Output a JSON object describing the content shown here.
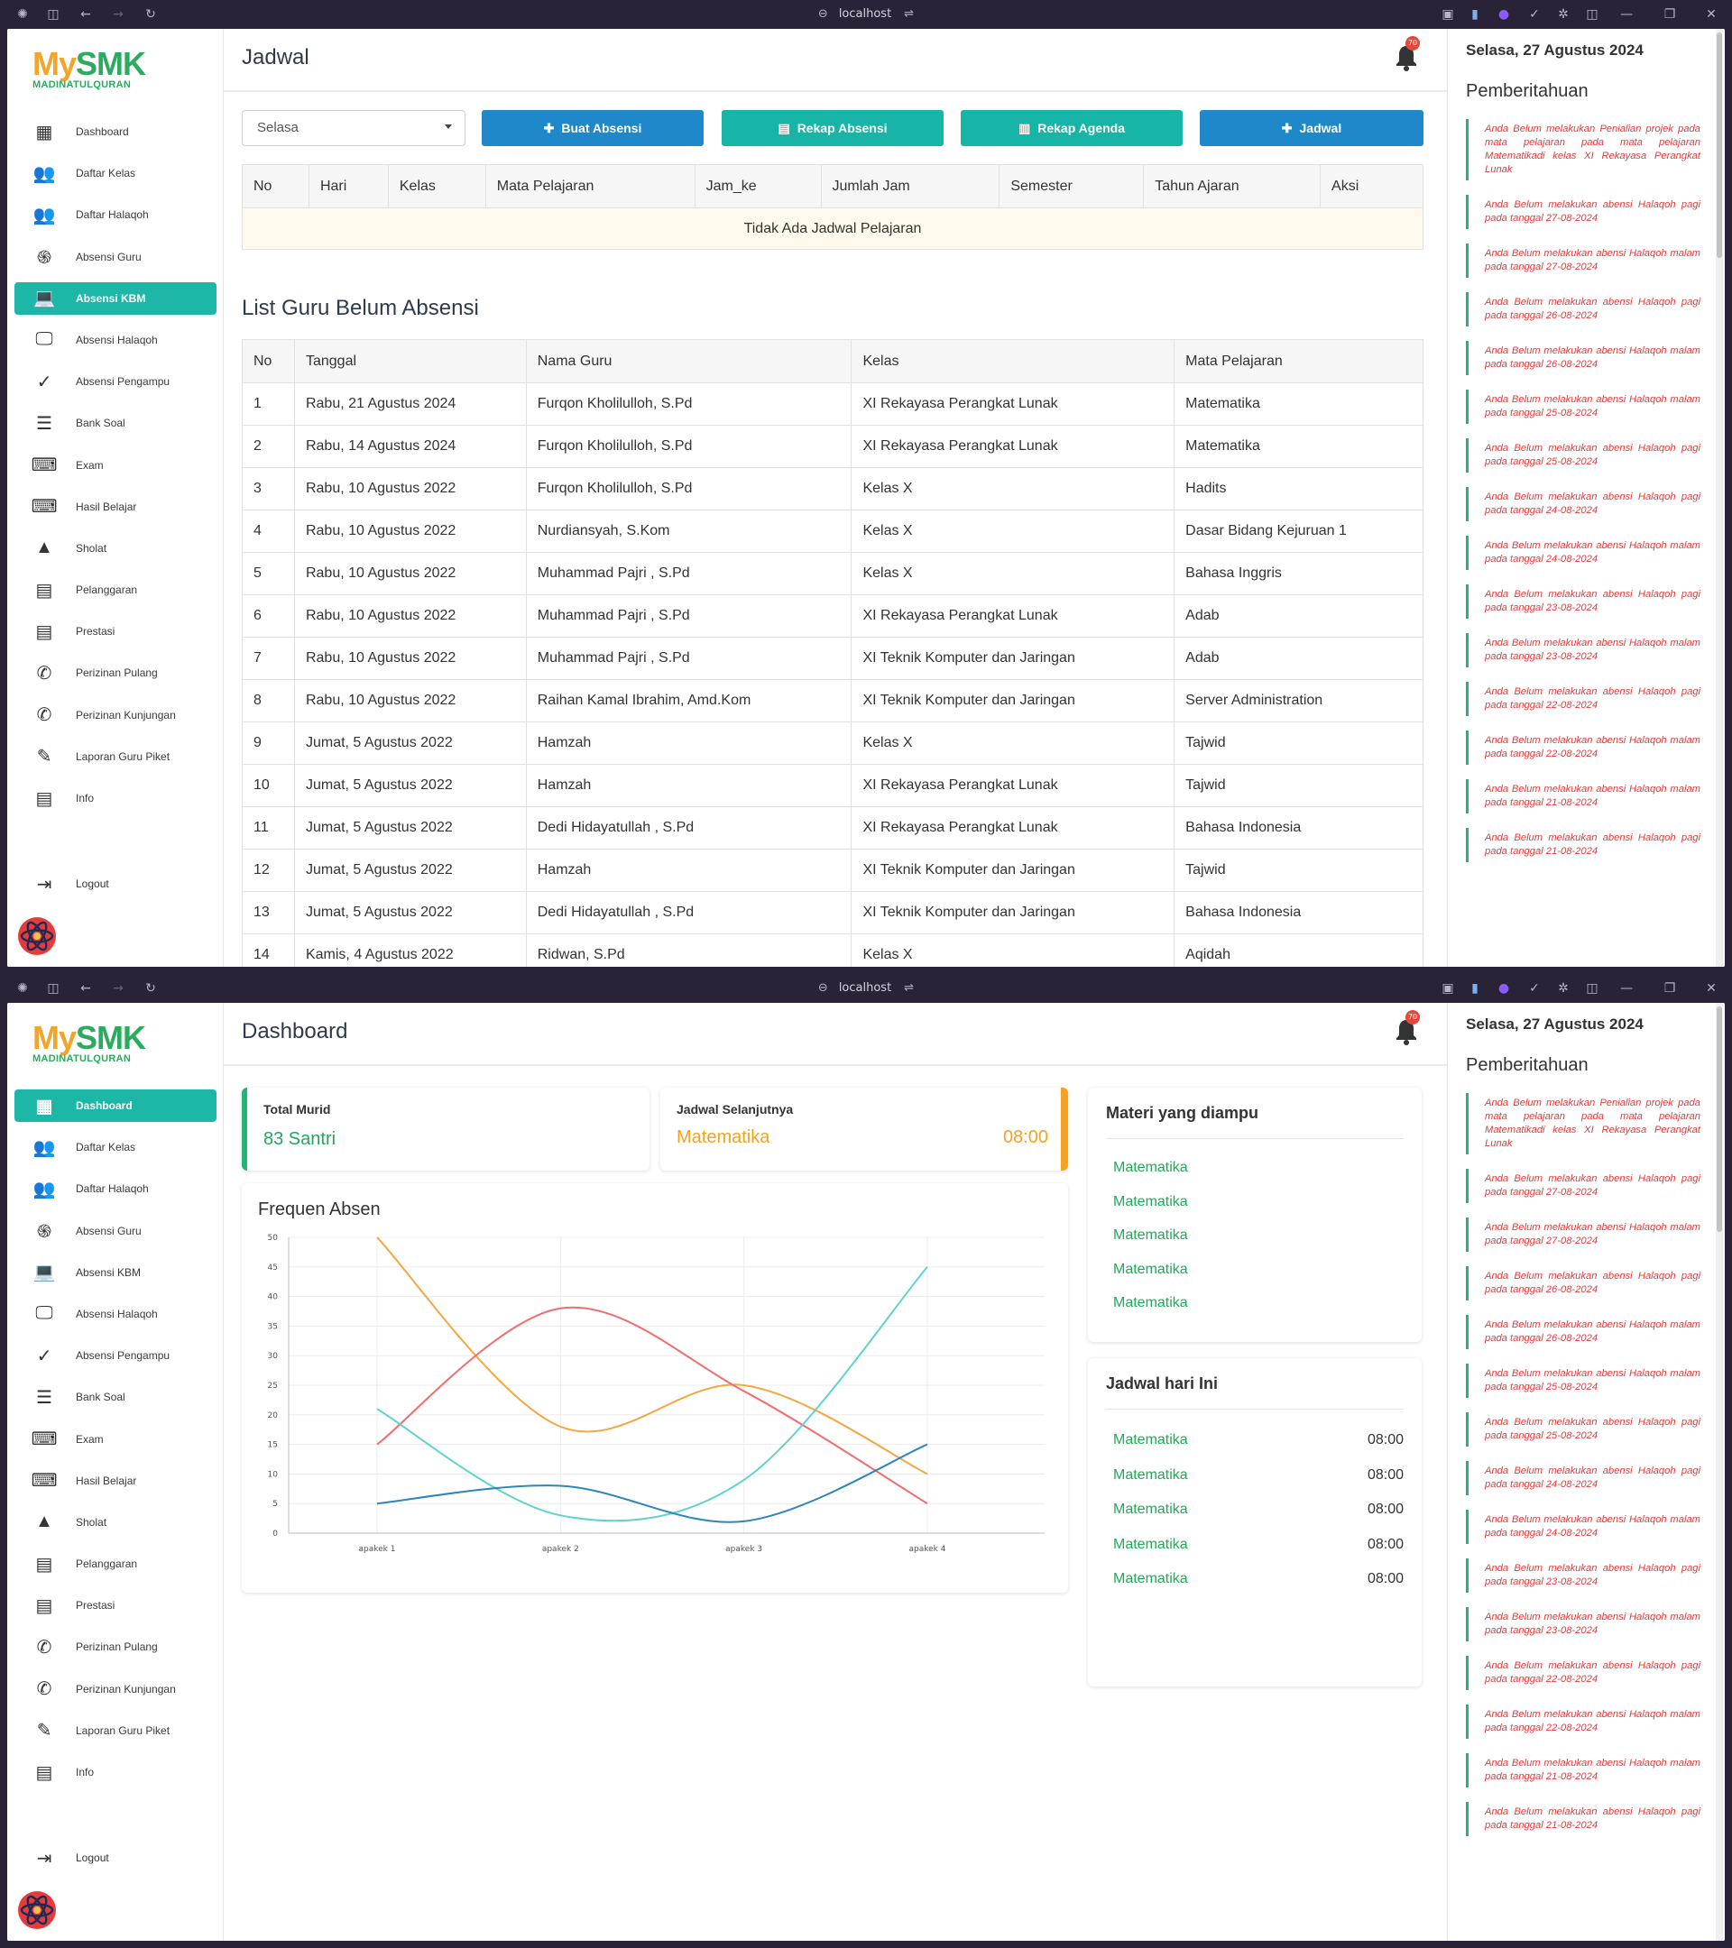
{
  "browser": {
    "url": "localhost"
  },
  "app": {
    "logo": {
      "my": "My",
      "smk": "SMK",
      "sub": "MADINATULQURAN"
    },
    "nav": [
      {
        "label": "Dashboard",
        "icon": "dashboard-icon"
      },
      {
        "label": "Daftar Kelas",
        "icon": "people-icon"
      },
      {
        "label": "Daftar Halaqoh",
        "icon": "group-icon"
      },
      {
        "label": "Absensi Guru",
        "icon": "fingerprint-icon"
      },
      {
        "label": "Absensi KBM",
        "icon": "laptop-icon"
      },
      {
        "label": "Absensi Halaqoh",
        "icon": "monitor-icon"
      },
      {
        "label": "Absensi Pengampu",
        "icon": "check-icon"
      },
      {
        "label": "Bank Soal",
        "icon": "align-icon"
      },
      {
        "label": "Exam",
        "icon": "keyboard-icon"
      },
      {
        "label": "Hasil Belajar",
        "icon": "keyboard-icon"
      },
      {
        "label": "Sholat",
        "icon": "navigation-icon"
      },
      {
        "label": "Pelanggaran",
        "icon": "list-doc-icon"
      },
      {
        "label": "Prestasi",
        "icon": "list-doc-icon"
      },
      {
        "label": "Perizinan Pulang",
        "icon": "phone-forward-icon"
      },
      {
        "label": "Perizinan Kunjungan",
        "icon": "phone-disabled-icon"
      },
      {
        "label": "Laporan Guru Piket",
        "icon": "pencil-icon"
      },
      {
        "label": "Info",
        "icon": "list-doc-icon"
      }
    ],
    "logout": "Logout",
    "notif_count": "70",
    "date": "Selasa, 27 Agustus 2024",
    "notif_title": "Pemberitahuan",
    "notifications": [
      "Anda Belum melakukan Penialian projek pada mata pelajaran pada mata pelajaran Matematikadi kelas XI Rekayasa Perangkat Lunak",
      "Anda Belum melakukan abensi Halaqoh pagi pada tanggal 27-08-2024",
      "Anda Belum melakukan abensi Halaqoh malam pada tanggal 27-08-2024",
      "Anda Belum melakukan abensi Halaqoh pagi pada tanggal 26-08-2024",
      "Anda Belum melakukan abensi Halaqoh malam pada tanggal 26-08-2024",
      "Anda Belum melakukan abensi Halaqoh malam pada tanggal 25-08-2024",
      "Anda Belum melakukan abensi Halaqoh pagi pada tanggal 25-08-2024",
      "Anda Belum melakukan abensi Halaqoh pagi pada tanggal 24-08-2024",
      "Anda Belum melakukan abensi Halaqoh malam pada tanggal 24-08-2024",
      "Anda Belum melakukan abensi Halaqoh pagi pada tanggal 23-08-2024",
      "Anda Belum melakukan abensi Halaqoh malam pada tanggal 23-08-2024",
      "Anda Belum melakukan abensi Halaqoh pagi pada tanggal 22-08-2024",
      "Anda Belum melakukan abensi Halaqoh malam pada tanggal 22-08-2024",
      "Anda Belum melakukan abensi Halaqoh malam pada tanggal 21-08-2024",
      "Anda Belum melakukan abensi Halaqoh pagi pada tanggal 21-08-2024"
    ]
  },
  "jadwal_page": {
    "title": "Jadwal",
    "active_nav": "Absensi KBM",
    "day_select": "Selasa",
    "buttons": [
      {
        "label": "Buat Absensi",
        "icon": "plus-icon",
        "color": "#1e88c9"
      },
      {
        "label": "Rekap Absensi",
        "icon": "keyboard-small-icon",
        "color": "#17b5a7"
      },
      {
        "label": "Rekap Agenda",
        "icon": "document-icon",
        "color": "#17b5a7"
      },
      {
        "label": "Jadwal",
        "icon": "plus-icon",
        "color": "#1e88c9"
      }
    ],
    "schedule_headers": [
      "No",
      "Hari",
      "Kelas",
      "Mata Pelajaran",
      "Jam_ke",
      "Jumlah Jam",
      "Semester",
      "Tahun Ajaran",
      "Aksi"
    ],
    "schedule_empty": "Tidak Ada Jadwal Pelajaran",
    "absence_title": "List Guru Belum Absensi",
    "absence_headers": [
      "No",
      "Tanggal",
      "Nama Guru",
      "Kelas",
      "Mata Pelajaran"
    ],
    "absence_rows": [
      [
        "1",
        "Rabu, 21 Agustus 2024",
        "Furqon Kholilulloh, S.Pd",
        "XI Rekayasa Perangkat Lunak",
        "Matematika"
      ],
      [
        "2",
        "Rabu, 14 Agustus 2024",
        "Furqon Kholilulloh, S.Pd",
        "XI Rekayasa Perangkat Lunak",
        "Matematika"
      ],
      [
        "3",
        "Rabu, 10 Agustus 2022",
        "Furqon Kholilulloh, S.Pd",
        "Kelas X",
        "Hadits"
      ],
      [
        "4",
        "Rabu, 10 Agustus 2022",
        "Nurdiansyah, S.Kom",
        "Kelas X",
        "Dasar Bidang Kejuruan 1"
      ],
      [
        "5",
        "Rabu, 10 Agustus 2022",
        "Muhammad Pajri , S.Pd",
        "Kelas X",
        "Bahasa Inggris"
      ],
      [
        "6",
        "Rabu, 10 Agustus 2022",
        "Muhammad Pajri , S.Pd",
        "XI Rekayasa Perangkat Lunak",
        "Adab"
      ],
      [
        "7",
        "Rabu, 10 Agustus 2022",
        "Muhammad Pajri , S.Pd",
        "XI Teknik Komputer dan Jaringan",
        "Adab"
      ],
      [
        "8",
        "Rabu, 10 Agustus 2022",
        "Raihan Kamal Ibrahim, Amd.Kom",
        "XI Teknik Komputer dan Jaringan",
        "Server Administration"
      ],
      [
        "9",
        "Jumat, 5 Agustus 2022",
        "Hamzah",
        "Kelas X",
        "Tajwid"
      ],
      [
        "10",
        "Jumat, 5 Agustus 2022",
        "Hamzah",
        "XI Rekayasa Perangkat Lunak",
        "Tajwid"
      ],
      [
        "11",
        "Jumat, 5 Agustus 2022",
        "Dedi Hidayatullah , S.Pd",
        "XI Rekayasa Perangkat Lunak",
        "Bahasa Indonesia"
      ],
      [
        "12",
        "Jumat, 5 Agustus 2022",
        "Hamzah",
        "XI Teknik Komputer dan Jaringan",
        "Tajwid"
      ],
      [
        "13",
        "Jumat, 5 Agustus 2022",
        "Dedi Hidayatullah , S.Pd",
        "XI Teknik Komputer dan Jaringan",
        "Bahasa Indonesia"
      ],
      [
        "14",
        "Kamis, 4 Agustus 2022",
        "Ridwan, S.Pd",
        "Kelas X",
        "Aqidah"
      ]
    ]
  },
  "dashboard_page": {
    "title": "Dashboard",
    "active_nav": "Dashboard",
    "total_murid_label": "Total Murid",
    "total_murid_value": "83 Santri",
    "next_label": "Jadwal Selanjutnya",
    "next_subject": "Matematika",
    "next_time": "08:00",
    "chart_title": "Frequen Absen",
    "materi_title": "Materi yang diampu",
    "materi": [
      "Matematika",
      "Matematika",
      "Matematika",
      "Matematika",
      "Matematika"
    ],
    "jadwal_title": "Jadwal hari Ini",
    "jadwal_today": [
      {
        "subject": "Matematika",
        "time": "08:00"
      },
      {
        "subject": "Matematika",
        "time": "08:00"
      },
      {
        "subject": "Matematika",
        "time": "08:00"
      },
      {
        "subject": "Matematika",
        "time": "08:00"
      },
      {
        "subject": "Matematika",
        "time": "08:00"
      }
    ]
  },
  "chart_data": {
    "type": "line",
    "title": "Frequen Absen",
    "categories": [
      "apakek 1",
      "apakek 2",
      "apakek 3",
      "apakek 4"
    ],
    "ylim": [
      0,
      50
    ],
    "yticks": [
      0,
      5,
      10,
      15,
      20,
      25,
      30,
      35,
      40,
      45,
      50
    ],
    "grid": true,
    "series": [
      {
        "values": [
          50,
          18,
          25,
          10
        ],
        "color": "#f5a742"
      },
      {
        "values": [
          15,
          38,
          24,
          5
        ],
        "color": "#f26d6d"
      },
      {
        "values": [
          21,
          3,
          9,
          45
        ],
        "color": "#5fd3cf"
      },
      {
        "values": [
          5,
          8,
          2,
          15
        ],
        "color": "#2f86b8"
      }
    ]
  }
}
